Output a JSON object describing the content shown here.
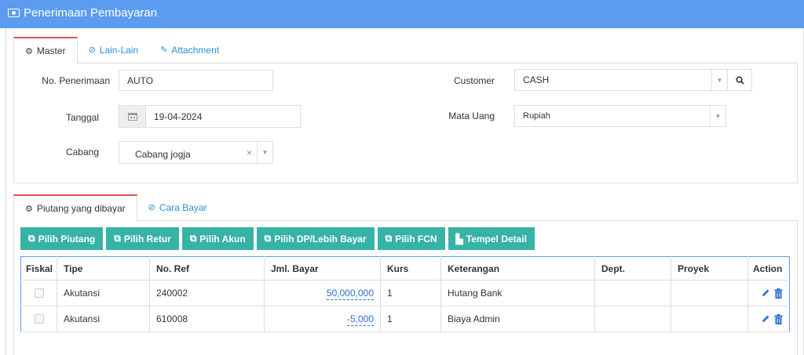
{
  "header": {
    "title": "Penerimaan Pembayaran",
    "icon": "cash-icon",
    "color": "#5b9bf0"
  },
  "master_tabs": [
    {
      "label": "Master",
      "icon": "cogs-icon",
      "active": true
    },
    {
      "label": "Lain-Lain",
      "icon": "check-circle-icon",
      "active": false
    },
    {
      "label": "Attachment",
      "icon": "paperclip-icon",
      "active": false
    }
  ],
  "form": {
    "no_penerimaan": {
      "label": "No. Penerimaan",
      "value": "AUTO"
    },
    "tanggal": {
      "label": "Tanggal",
      "value": "19-04-2024"
    },
    "cabang": {
      "label": "Cabang",
      "value": "Cabang jogja"
    },
    "customer": {
      "label": "Customer",
      "value": "CASH"
    },
    "mata_uang": {
      "label": "Mata Uang",
      "value": "Rupiah"
    }
  },
  "detail_tabs": [
    {
      "label": "Piutang yang dibayar",
      "icon": "cogs-icon",
      "active": true
    },
    {
      "label": "Cara Bayar",
      "icon": "check-circle-icon",
      "active": false
    }
  ],
  "buttons": [
    {
      "label": "Pilih Piutang",
      "icon": "copy-icon"
    },
    {
      "label": "Pilih Retur",
      "icon": "copy-icon"
    },
    {
      "label": "Pilih Akun",
      "icon": "copy-icon"
    },
    {
      "label": "Pilih DP/Lebih Bayar",
      "icon": "copy-icon"
    },
    {
      "label": "Pilih FCN",
      "icon": "copy-icon"
    },
    {
      "label": "Tempel Detail",
      "icon": "paste-icon"
    }
  ],
  "button_color": "#37b3a6",
  "table": {
    "columns": [
      "Fiskal",
      "Tipe",
      "No. Ref",
      "Jml. Bayar",
      "Kurs",
      "Keterangan",
      "Dept.",
      "Proyek",
      "Action"
    ],
    "rows": [
      {
        "fiskal": false,
        "tipe": "Akutansi",
        "no_ref": "240002",
        "jml_bayar": "50,000,000",
        "kurs": "1",
        "keterangan": "Hutang Bank",
        "dept": "",
        "proyek": ""
      },
      {
        "fiskal": false,
        "tipe": "Akutansi",
        "no_ref": "610008",
        "jml_bayar": "-5,000",
        "kurs": "1",
        "keterangan": "Biaya Admin",
        "dept": "",
        "proyek": ""
      }
    ]
  }
}
